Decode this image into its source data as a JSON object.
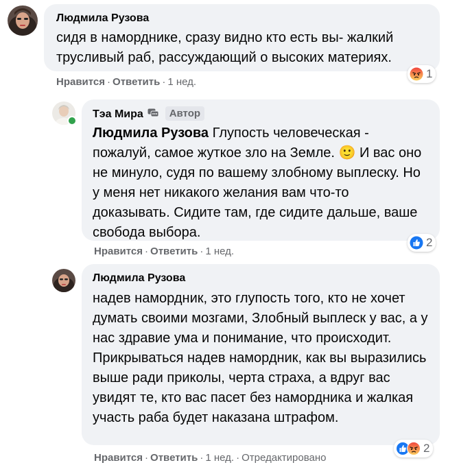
{
  "comments": [
    {
      "author": "Людмила Рузова",
      "text": "сидя в наморднике, сразу видно кто есть вы- жалкий трусливый раб, рассуждающий о высоких материях.",
      "actions": {
        "like": "Нравится",
        "reply": "Ответить",
        "time": "1 нед."
      },
      "reaction_count": "1",
      "reaction_types": [
        "angry"
      ]
    },
    {
      "author": "Тэа Мира",
      "author_badge": "Автор",
      "mention": "Людмила Рузова",
      "text": "Глупость человеческая - пожалуй, самое жуткое зло на Земле. 🙂 И вас оно не минуло, судя по вашему злобному выплеску. Но у меня нет никакого желания вам что-то доказывать. Сидите там, где сидите дальше, ваше свобода выбора.",
      "actions": {
        "like": "Нравится",
        "reply": "Ответить",
        "time": "1 нед."
      },
      "reaction_count": "2",
      "reaction_types": [
        "like"
      ]
    },
    {
      "author": "Людмила Рузова",
      "text": "надев намордник, это глупость того, кто не хочет думать своими мозгами, Злобный выплеск у вас, а у нас здравие ума и понимание, что происходит. Прикрываться надев намордник, как вы выразились выше ради приколы, черта страха, а вдруг вас увидят те, кто вас пасет без намордника и жалкая участь раба будет наказана штрафом.",
      "actions": {
        "like": "Нравится",
        "reply": "Ответить",
        "time": "1 нед.",
        "edited": "Отредактировано"
      },
      "reaction_count": "2",
      "reaction_types": [
        "like",
        "angry"
      ]
    }
  ],
  "colors": {
    "bubble": "#f0f2f5",
    "meta": "#65676b",
    "like": "#1877f2",
    "angry": "#f7714c",
    "online": "#31a24c"
  }
}
